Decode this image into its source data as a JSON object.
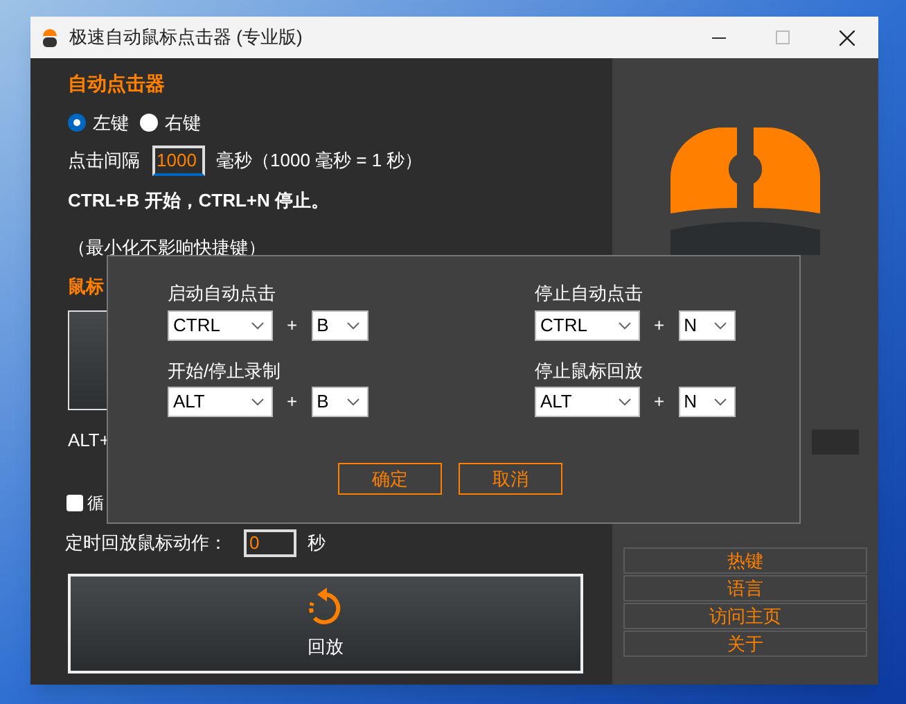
{
  "window": {
    "title": "极速自动鼠标点击器 (专业版)"
  },
  "clicker": {
    "title": "自动点击器",
    "buttons": [
      {
        "label": "左键",
        "selected": true
      },
      {
        "label": "右键",
        "selected": false
      }
    ],
    "interval_label": "点击间隔",
    "interval_value": "1000",
    "interval_hint": "毫秒（1000 毫秒 = 1 秒）",
    "hotkey_note": "CTRL+B 开始，CTRL+N 停止。",
    "minimize_note": "（最小化不影响快捷键）"
  },
  "recorder": {
    "title": "鼠标",
    "hotkey_note": "ALT+",
    "loop": {
      "label": "循",
      "checked": false
    },
    "timer_label": "定时回放鼠标动作：",
    "timer_value": "0",
    "timer_unit": "秒",
    "replay_label": "回放"
  },
  "side_menu": [
    "热键",
    "语言",
    "访问主页",
    "关于"
  ],
  "dialog": {
    "groups": [
      {
        "label": "启动自动点击",
        "modifier": "CTRL",
        "key": "B"
      },
      {
        "label": "停止自动点击",
        "modifier": "CTRL",
        "key": "N"
      },
      {
        "label": "开始/停止录制",
        "modifier": "ALT",
        "key": "B"
      },
      {
        "label": "停止鼠标回放",
        "modifier": "ALT",
        "key": "N"
      }
    ],
    "plus": "+",
    "ok": "确定",
    "cancel": "取消"
  }
}
